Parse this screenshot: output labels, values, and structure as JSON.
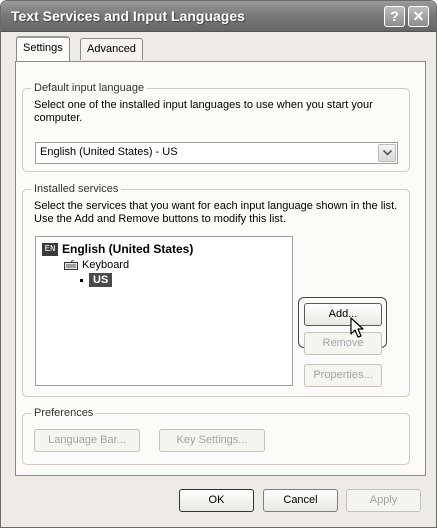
{
  "window": {
    "title": "Text Services and Input Languages",
    "help_glyph": "?",
    "close_glyph": "✕"
  },
  "tabs": [
    {
      "label": "Settings",
      "selected": true
    },
    {
      "label": "Advanced",
      "selected": false
    }
  ],
  "default_input_language": {
    "legend": "Default input language",
    "description": "Select one of the installed input languages to use when you start your computer.",
    "selected_value": "English (United States) - US"
  },
  "installed_services": {
    "legend": "Installed services",
    "description": "Select the services that you want for each input language shown in the list. Use the Add and Remove buttons to modify this list.",
    "tree": {
      "language_badge": "EN",
      "language": "English (United States)",
      "category": "Keyboard",
      "layout": "US"
    },
    "buttons": {
      "add": "Add...",
      "remove": "Remove",
      "properties": "Properties..."
    }
  },
  "preferences": {
    "legend": "Preferences",
    "language_bar": "Language Bar...",
    "key_settings": "Key Settings..."
  },
  "footer": {
    "ok": "OK",
    "cancel": "Cancel",
    "apply": "Apply"
  },
  "icons": [
    "help-icon",
    "close-icon",
    "dropdown-arrow-icon",
    "keyboard-icon",
    "pointer-cursor-icon"
  ]
}
